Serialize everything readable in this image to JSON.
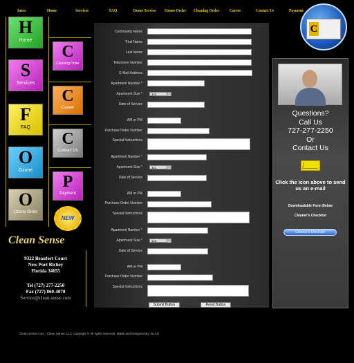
{
  "nav": [
    "Intro",
    "Home",
    "Services",
    "FAQ",
    "Ozone Service",
    "Ozone Order",
    "Cleaning Order",
    "Career",
    "Contact Us",
    "Payment"
  ],
  "tiles": {
    "home": {
      "letter": "H",
      "label": "Home"
    },
    "services": {
      "letter": "S",
      "label": "Services"
    },
    "faq": {
      "letter": "F",
      "label": "FAQ"
    },
    "ozone": {
      "letter": "O",
      "label": "Ozone"
    },
    "ozone_order": {
      "letter": "O",
      "label": "Ozone Order"
    },
    "cleaning_order": {
      "letter": "C",
      "label": "Cleaning Order"
    },
    "career": {
      "letter": "C",
      "label": "Career"
    },
    "contact": {
      "letter": "C",
      "label": "Contact Us"
    },
    "payment": {
      "letter": "P",
      "label": "Payment"
    },
    "new_badge": "NEW"
  },
  "brand": {
    "name": "Clean Sense",
    "address1": "9322 Beaufort Court",
    "address2": "New Port Richey",
    "address3": "Florida 34655",
    "tel": "Tel (727) 277-2250",
    "fax": "Fax (727) 860-4070",
    "email": "Service@clean-sense.com"
  },
  "form": {
    "community": "Community Name",
    "first": "First Name",
    "last": "Last Name",
    "phone": "Telephone Number",
    "email": "E-Mail Address",
    "apt": "Apartment Number *",
    "size": "Apartment Size *",
    "size_value": "1x1",
    "date": "Date of Service",
    "ampm": "AM or PM",
    "po": "Purchase Order Number",
    "special": "Special Instructions",
    "submit": "Submit Button",
    "reset": "Reset Button"
  },
  "right": {
    "q1": "Questions?",
    "q2": "Call Us",
    "q3": "727-277-2250",
    "q4": "Or",
    "q5": "Contact Us",
    "click1": "Click the Icon above to send",
    "click2": "us an e-mail",
    "download": "Downloadable Form Below",
    "checklist": "Cleaner's Checklist",
    "checklist_btn": "Cleaner's Checklist"
  },
  "footer": "Clean-Sense.com - Clean Sense, LLC Copyright © All rights reserved. Made and Designed By: BLAD",
  "colors": {
    "accent": "#f4d000",
    "green": "#2fbf2f",
    "magenta": "#d62fd6",
    "yellow": "#f0e000",
    "cyan": "#22aee0"
  }
}
